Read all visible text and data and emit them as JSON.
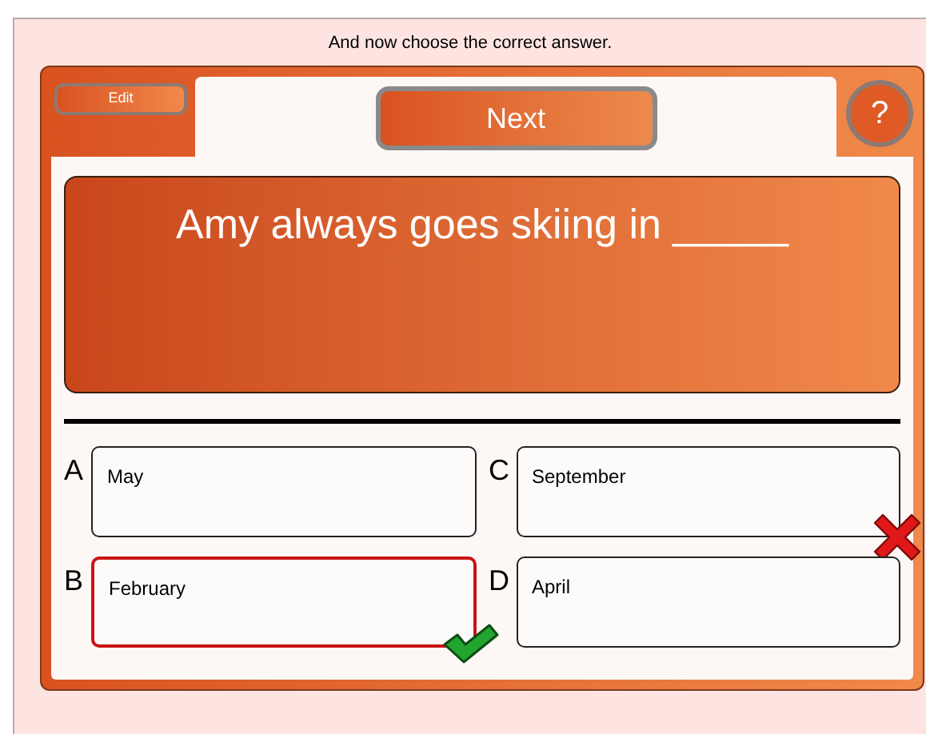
{
  "instruction": "And now choose the correct answer.",
  "edit_button": "Edit",
  "next_button": "Next",
  "help_button": "?",
  "question": "Amy always goes skiing in _____",
  "answers": [
    {
      "letter": "A",
      "text": "May",
      "selected": false,
      "correct_mark": false,
      "wrong_mark": false
    },
    {
      "letter": "C",
      "text": "September",
      "selected": false,
      "correct_mark": false,
      "wrong_mark": true
    },
    {
      "letter": "B",
      "text": "February",
      "selected": true,
      "correct_mark": true,
      "wrong_mark": false
    },
    {
      "letter": "D",
      "text": "April",
      "selected": false,
      "correct_mark": false,
      "wrong_mark": false
    }
  ]
}
